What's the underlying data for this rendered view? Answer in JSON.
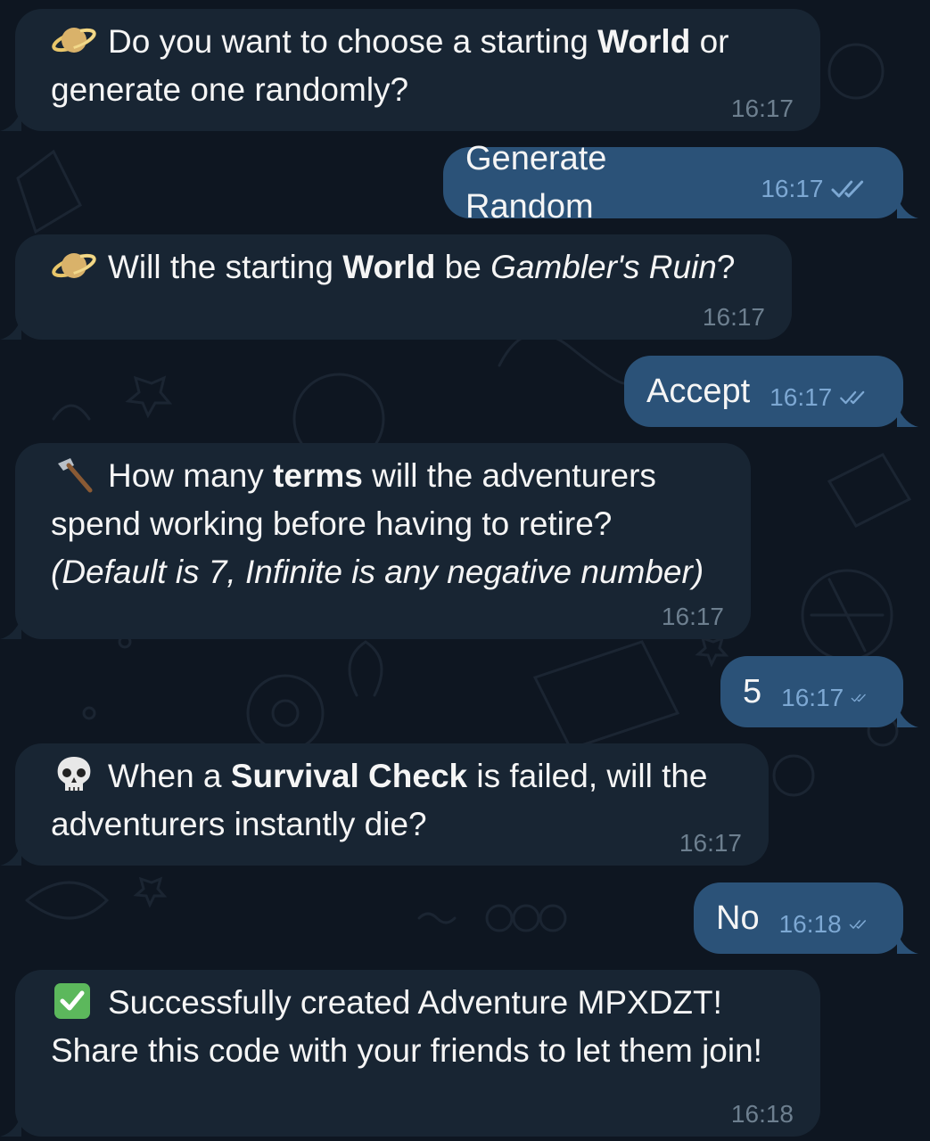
{
  "messages": [
    {
      "id": "m1",
      "direction": "incoming",
      "icon": "ringed-planet-icon",
      "text_parts": {
        "p1": "Do you want to choose a starting ",
        "p2": "World",
        "p3": " or generate one randomly?"
      },
      "time": "16:17"
    },
    {
      "id": "m2",
      "direction": "outgoing",
      "text": "Generate Random",
      "time": "16:17",
      "status": "read"
    },
    {
      "id": "m3",
      "direction": "incoming",
      "icon": "ringed-planet-icon",
      "text_parts": {
        "p1": "Will the starting ",
        "p2": "World",
        "p3": " be ",
        "p4": "Gambler's Ruin",
        "p5": "?"
      },
      "time": "16:17"
    },
    {
      "id": "m4",
      "direction": "outgoing",
      "text": "Accept",
      "time": "16:17",
      "status": "read"
    },
    {
      "id": "m5",
      "direction": "incoming",
      "icon": "hammer-icon",
      "text_parts": {
        "p1": "How many ",
        "p2": "terms",
        "p3": " will the adventurers spend working before having to retire?",
        "p4": "(Default is 7, Infinite is any negative number)"
      },
      "time": "16:17"
    },
    {
      "id": "m6",
      "direction": "outgoing",
      "text": "5",
      "time": "16:17",
      "status": "read"
    },
    {
      "id": "m7",
      "direction": "incoming",
      "icon": "skull-icon",
      "text_parts": {
        "p1": "When a ",
        "p2": "Survival Check",
        "p3": " is failed, will the adventurers instantly die?"
      },
      "time": "16:17"
    },
    {
      "id": "m8",
      "direction": "outgoing",
      "text": "No",
      "time": "16:18",
      "status": "read"
    },
    {
      "id": "m9",
      "direction": "incoming",
      "icon": "check-mark-button-icon",
      "text_parts": {
        "p1": "Successfully created Adventure MPXDZT! Share this code with your friends to let them join!"
      },
      "time": "16:18"
    }
  ],
  "colors": {
    "background": "#0e1621",
    "incoming_bubble": "#182533",
    "outgoing_bubble": "#2b5278",
    "incoming_time": "#6d7f8f",
    "outgoing_time": "#7da8d3"
  }
}
